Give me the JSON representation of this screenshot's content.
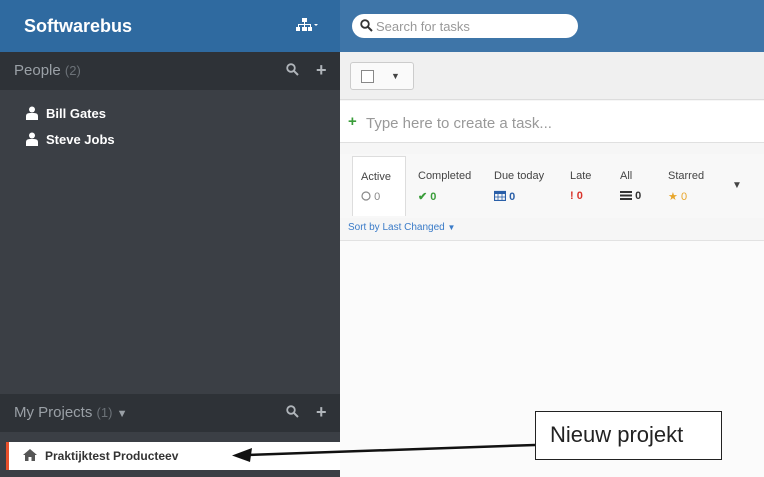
{
  "topbar": {
    "brand": "Softwarebus",
    "search_placeholder": "Search for tasks"
  },
  "sidebar": {
    "people": {
      "title": "People",
      "count": "(2)",
      "items": [
        "Bill Gates",
        "Steve Jobs"
      ]
    },
    "projects": {
      "title": "My Projects",
      "count": "(1)",
      "items": [
        "Praktijktest Producteev"
      ]
    }
  },
  "main": {
    "create_placeholder": "Type here to create a task...",
    "filters": [
      {
        "label": "Active",
        "count": "0",
        "icon": "circle-icon",
        "color": "#888888"
      },
      {
        "label": "Completed",
        "count": "0",
        "icon": "check-icon",
        "color": "#3a9d3a"
      },
      {
        "label": "Due today",
        "count": "0",
        "icon": "calendar-icon",
        "color": "#2a5fa8"
      },
      {
        "label": "Late",
        "count": "0",
        "icon": "exclamation-icon",
        "color": "#d9342b"
      },
      {
        "label": "All",
        "count": "0",
        "icon": "list-icon",
        "color": "#333333"
      },
      {
        "label": "Starred",
        "count": "0",
        "icon": "star-icon",
        "color": "#e8a62b"
      }
    ],
    "sort_label": "Sort by Last Changed"
  },
  "annotation": {
    "text": "Nieuw projekt"
  },
  "colors": {
    "topbar": "#3e75a8",
    "sidebar": "#3b3f45",
    "accent": "#e8502b",
    "link": "#3a7bc8"
  }
}
